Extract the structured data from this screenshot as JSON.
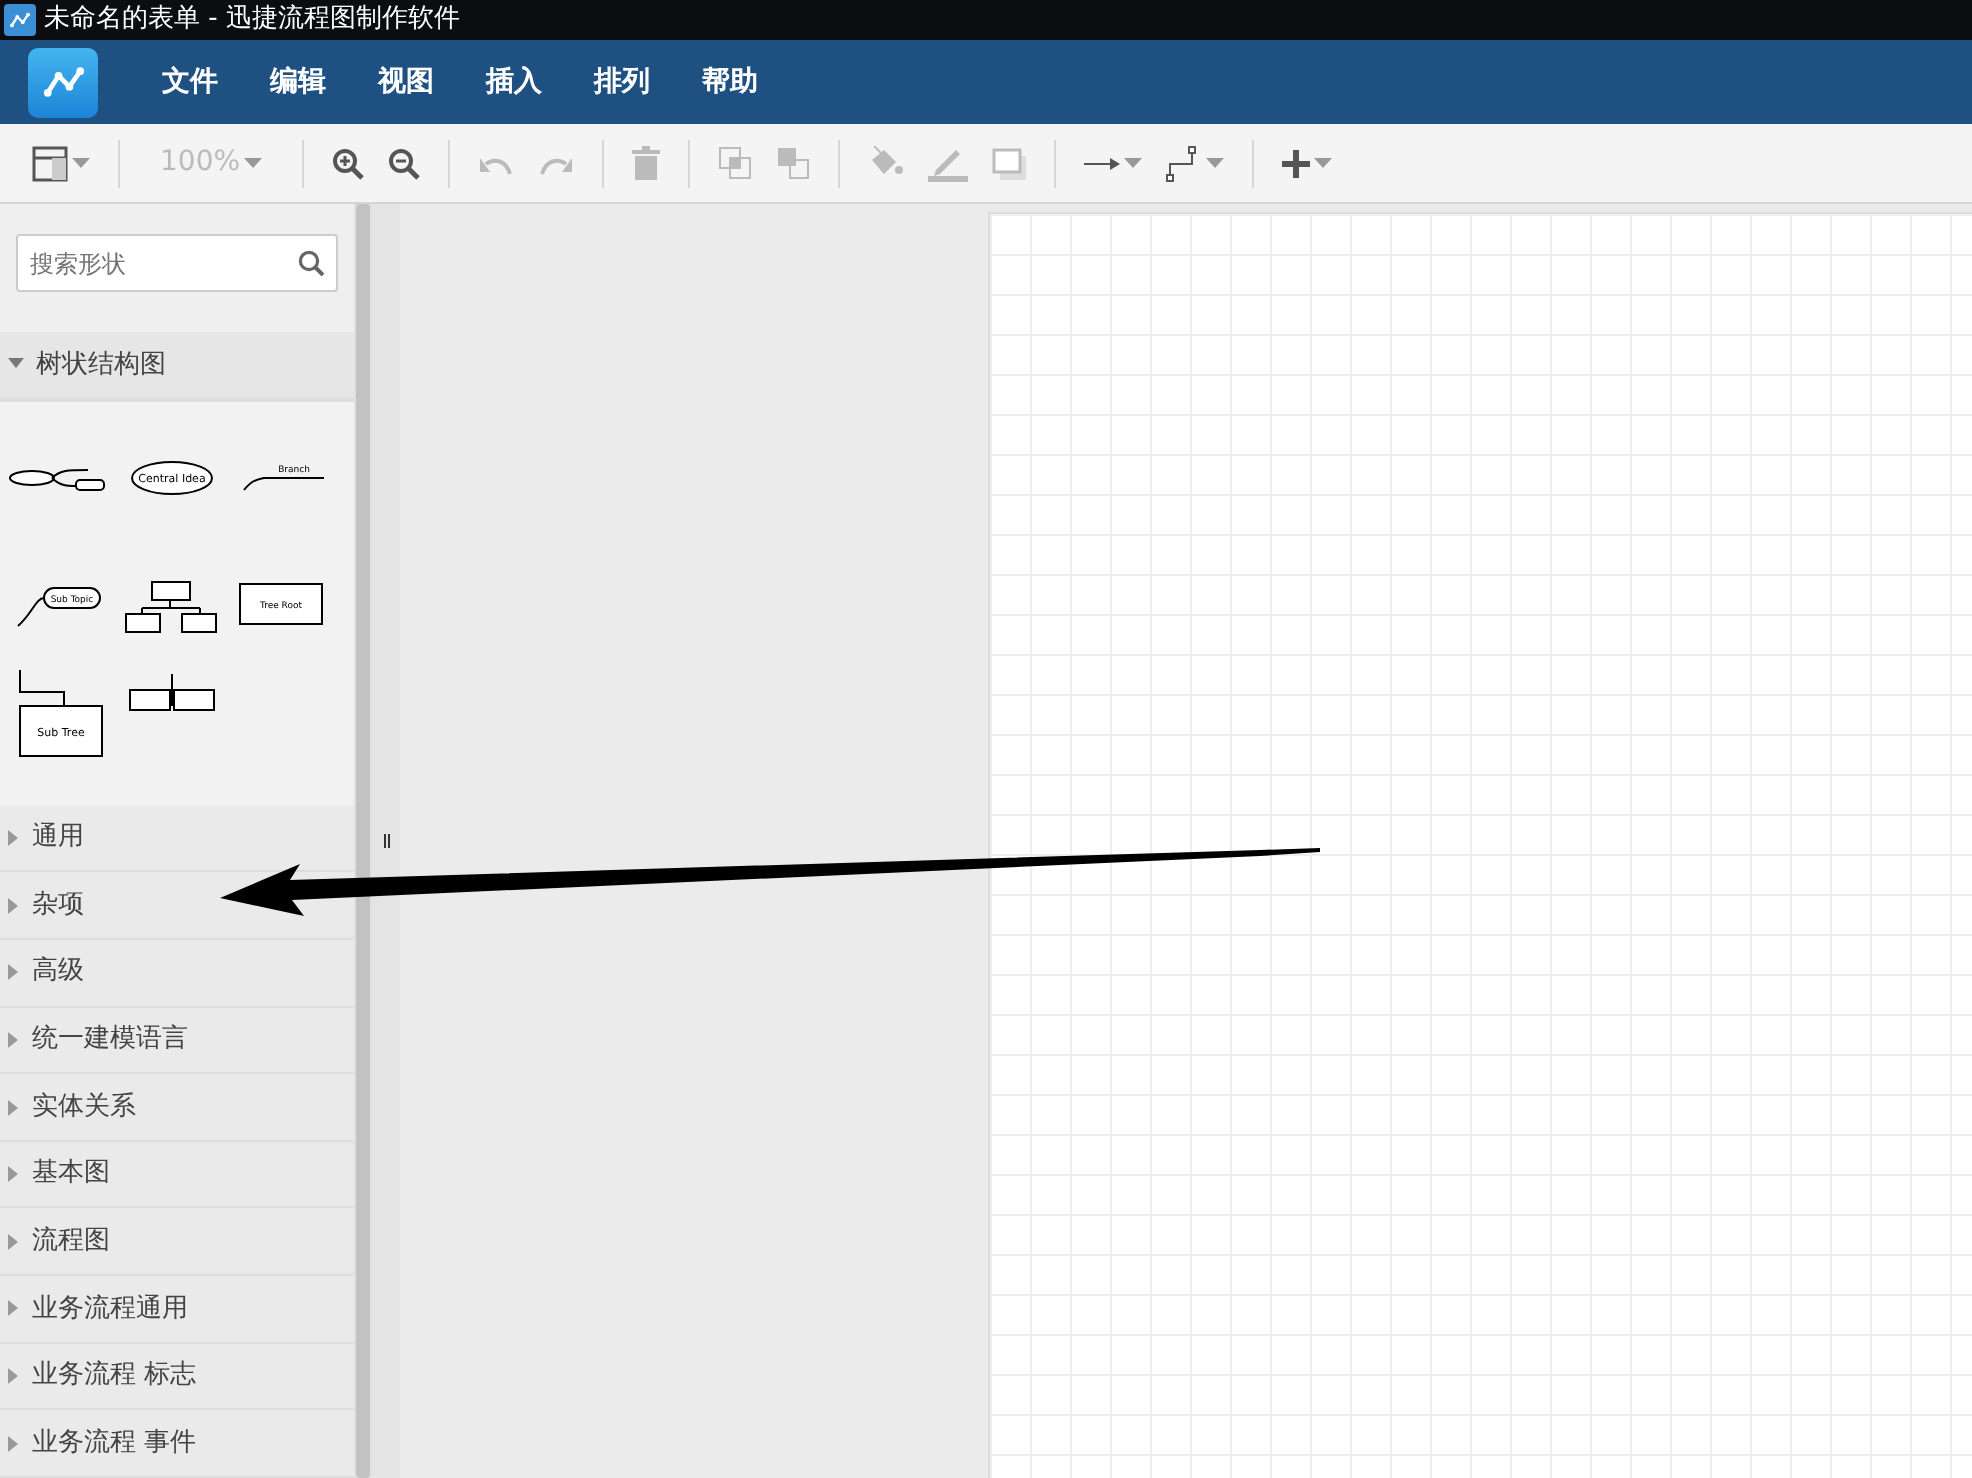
{
  "window": {
    "title": "未命名的表单 - 迅捷流程图制作软件"
  },
  "menu": [
    "文件",
    "编辑",
    "视图",
    "插入",
    "排列",
    "帮助"
  ],
  "toolbar": [
    {
      "kind": "format",
      "disabled": false
    },
    {
      "kind": "sep"
    },
    {
      "kind": "zoom",
      "label": "100%",
      "disabled": true
    },
    {
      "kind": "sep"
    },
    {
      "kind": "zoomin",
      "disabled": false
    },
    {
      "kind": "zoomout",
      "disabled": false
    },
    {
      "kind": "sep"
    },
    {
      "kind": "undo",
      "disabled": true
    },
    {
      "kind": "redo",
      "disabled": true
    },
    {
      "kind": "sep"
    },
    {
      "kind": "delete",
      "disabled": true
    },
    {
      "kind": "sep"
    },
    {
      "kind": "tofront",
      "disabled": true
    },
    {
      "kind": "toback",
      "disabled": true
    },
    {
      "kind": "sep"
    },
    {
      "kind": "fill",
      "disabled": true
    },
    {
      "kind": "line",
      "disabled": true
    },
    {
      "kind": "shadow",
      "disabled": true
    },
    {
      "kind": "sep"
    },
    {
      "kind": "connection",
      "disabled": false
    },
    {
      "kind": "waypoints",
      "disabled": false
    },
    {
      "kind": "sep"
    },
    {
      "kind": "insert",
      "disabled": false
    }
  ],
  "sidebar": {
    "search": {
      "placeholder": "搜索形状"
    },
    "sections": [
      {
        "title": "树状结构图",
        "expanded": true,
        "shapes": [
          {
            "kind": "mindmap"
          },
          {
            "kind": "ellipse",
            "label": "Central Idea"
          },
          {
            "kind": "branch",
            "label": "Branch"
          },
          {
            "kind": "subtopic",
            "label": "Sub Topic"
          },
          {
            "kind": "orgchart"
          },
          {
            "kind": "rect",
            "label": "Tree Root"
          },
          {
            "kind": "subtree",
            "label": "Sub Tree"
          },
          {
            "kind": "split"
          }
        ]
      },
      {
        "title": "通用",
        "expanded": false
      },
      {
        "title": "杂项",
        "expanded": false
      },
      {
        "title": "高级",
        "expanded": false
      },
      {
        "title": "统一建模语言",
        "expanded": false
      },
      {
        "title": "实体关系",
        "expanded": false
      },
      {
        "title": "基本图",
        "expanded": false
      },
      {
        "title": "流程图",
        "expanded": false
      },
      {
        "title": "业务流程通用",
        "expanded": false
      },
      {
        "title": "业务流程 标志",
        "expanded": false
      },
      {
        "title": "业务流程 事件",
        "expanded": false
      }
    ]
  }
}
